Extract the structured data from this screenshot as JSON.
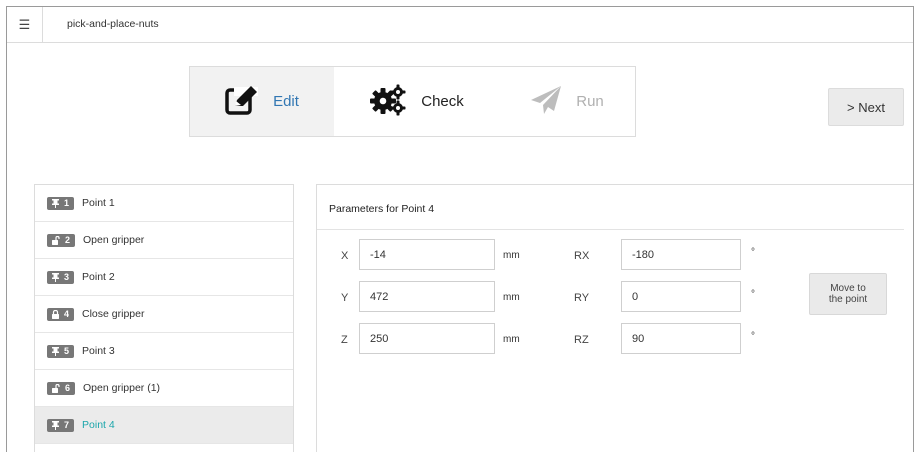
{
  "header": {
    "menu_icon": "hamburger-menu-icon",
    "project_title": "pick-and-place-nuts"
  },
  "wizard": {
    "steps": [
      {
        "label": "Edit",
        "icon": "edit-icon",
        "state": "active"
      },
      {
        "label": "Check",
        "icon": "gears-icon",
        "state": "enabled"
      },
      {
        "label": "Run",
        "icon": "paper-plane-icon",
        "state": "disabled"
      }
    ],
    "next_label": "> Next"
  },
  "program": {
    "items": [
      {
        "num": "1",
        "icon": "pin-icon",
        "label": "Point 1",
        "active": false
      },
      {
        "num": "2",
        "icon": "unlock-icon",
        "label": "Open gripper",
        "active": false
      },
      {
        "num": "3",
        "icon": "pin-icon",
        "label": "Point 2",
        "active": false
      },
      {
        "num": "4",
        "icon": "lock-icon",
        "label": "Close gripper",
        "active": false
      },
      {
        "num": "5",
        "icon": "pin-icon",
        "label": "Point 3",
        "active": false
      },
      {
        "num": "6",
        "icon": "unlock-icon",
        "label": "Open gripper (1)",
        "active": false
      },
      {
        "num": "7",
        "icon": "pin-icon",
        "label": "Point 4",
        "active": true
      }
    ]
  },
  "params": {
    "title": "Parameters for  Point 4",
    "position": [
      {
        "axis": "X",
        "value": "-14",
        "unit": "mm"
      },
      {
        "axis": "Y",
        "value": "472",
        "unit": "mm"
      },
      {
        "axis": "Z",
        "value": "250",
        "unit": "mm"
      }
    ],
    "rotation": [
      {
        "axis": "RX",
        "value": "-180",
        "unit": "°"
      },
      {
        "axis": "RY",
        "value": "0",
        "unit": "°"
      },
      {
        "axis": "RZ",
        "value": "90",
        "unit": "°"
      }
    ],
    "move_label_line1": "Move to",
    "move_label_line2": "the point"
  },
  "colors": {
    "accent": "#3277b3",
    "active_item": "#1ba6ab",
    "badge": "#777777",
    "disabled": "#b0b0b0"
  }
}
